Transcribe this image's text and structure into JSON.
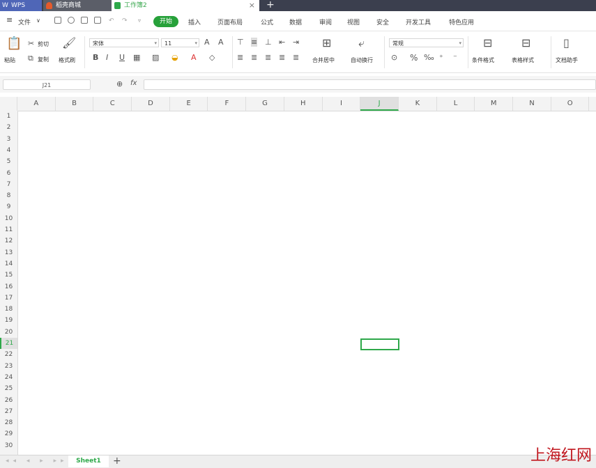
{
  "tabs": {
    "wps": "WPS",
    "daoke": "稻壳商城",
    "workbook": "工作簿2",
    "close": "×",
    "new_tab": "+"
  },
  "menu": {
    "file": "文件",
    "items": [
      "开始",
      "插入",
      "页面布局",
      "公式",
      "数据",
      "审阅",
      "视图",
      "安全",
      "开发工具",
      "特色应用"
    ]
  },
  "ribbon": {
    "paste": "粘贴",
    "cut": "剪切",
    "copy": "复制",
    "format_painter": "格式刷",
    "font": "宋体",
    "size": "11",
    "bold": "B",
    "italic": "I",
    "underline": "U",
    "merge_center": "合并居中",
    "wrap_text": "自动换行",
    "number_format": "常规",
    "percent": "%",
    "cond_format": "条件格式",
    "table_style": "表格样式",
    "doc_helper": "文档助手"
  },
  "formula_bar": {
    "name_box": "J21",
    "fx": "fx"
  },
  "grid": {
    "columns": [
      "A",
      "B",
      "C",
      "D",
      "E",
      "F",
      "G",
      "H",
      "I",
      "J",
      "K",
      "L",
      "M",
      "N",
      "O"
    ],
    "rows": [
      "1",
      "2",
      "3",
      "4",
      "5",
      "6",
      "7",
      "8",
      "9",
      "10",
      "11",
      "12",
      "13",
      "14",
      "15",
      "16",
      "17",
      "18",
      "19",
      "20",
      "21",
      "22",
      "23",
      "24",
      "25",
      "26",
      "27",
      "28",
      "29",
      "30"
    ],
    "selected_column": "J",
    "selected_row": "21"
  },
  "sheets": {
    "active": "Sheet1",
    "add": "+"
  },
  "watermark": "上海红网",
  "colors": {
    "accent": "#27a13a",
    "titlebar": "#3b3f4e",
    "wps_tab": "#4f66b7"
  }
}
